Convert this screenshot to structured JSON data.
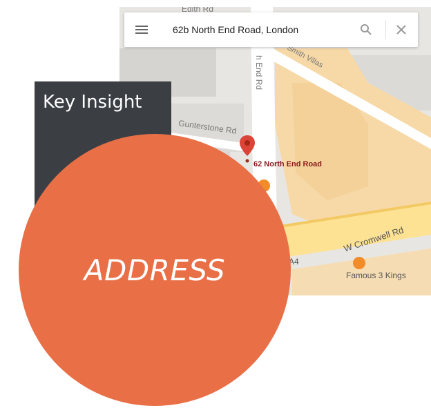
{
  "map": {
    "search": {
      "value": "62b North End Road, London",
      "menu_icon": "hamburger-menu-icon",
      "search_icon": "search-icon",
      "close_icon": "close-icon"
    },
    "labels": {
      "edith_rd": "Edith Rd",
      "north_end_rd": "h End Rd",
      "smith_villas": "Smith Villas",
      "gunterstone_rd": "Gunterstone Rd",
      "pin_label": "62 North End Road",
      "w_cromwell_rd": "W Cromwell Rd",
      "a4": "A4",
      "famous_3_kings": "Famous 3 Kings"
    },
    "colors": {
      "pin": "#db4437",
      "poi_marker": "#f28c28",
      "road_major": "#fde293",
      "building": "#f7d9a8"
    }
  },
  "insight": {
    "title": "Key Insight"
  },
  "circle": {
    "text": "ADDRESS",
    "color": "#e96f47"
  }
}
